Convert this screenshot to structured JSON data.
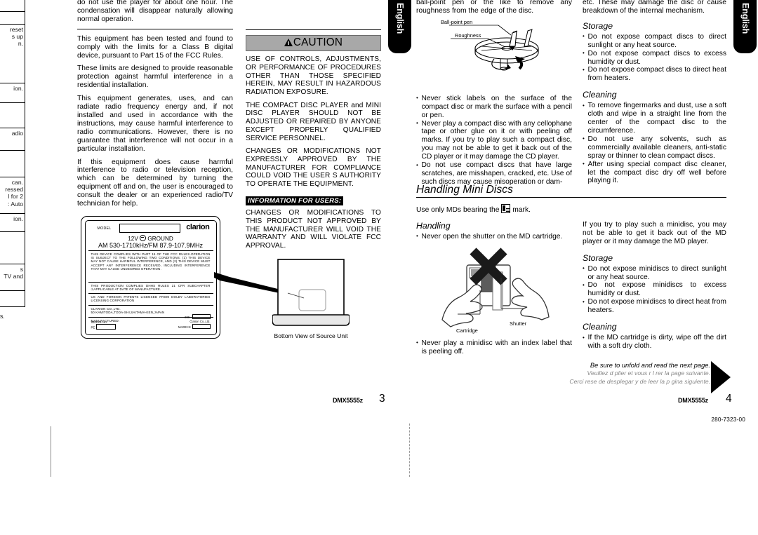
{
  "document": {
    "model": "DMX5555z",
    "doc_number": "280-7323-00",
    "page_left": "3",
    "page_right": "4",
    "tab_label": "English"
  },
  "left_crop": {
    "fragments": [
      "reset",
      "s up",
      "n.",
      "ion.",
      "adio",
      "can.",
      "ressed",
      "l for 2",
      ": Auto",
      "ion.",
      "s",
      "TV and"
    ],
    "tail": "s."
  },
  "col1": {
    "intro_top": "do not use the player for about one hour. The condensation will disappear naturally allowing normal operation.",
    "fcc_paragraphs": [
      "This equipment has been tested and found to comply with the limits for a Class B digital device, pursuant to Part 15 of the FCC Rules.",
      "These limits are designed to provide reasonable protection against harmful interference in a residential installation.",
      "This equipment generates, uses, and can radiate radio frequency energy and, if not installed and used in accordance with the instructions, may cause harmful interference to radio communications. However, there is no guarantee that interference will not occur in a particular installation.",
      "If this equipment does cause harmful interference to radio or television reception, which can be determined by turning the equipment off and on, the user is encouraged to consult the dealer or an experienced radio/TV technician for help."
    ]
  },
  "caution": {
    "title": "CAUTION",
    "paragraphs": [
      "USE OF CONTROLS, ADJUSTMENTS, OR PERFORMANCE OF PROCEDURES OTHER THAN THOSE SPECIFIED HEREIN, MAY RESULT IN HAZARDOUS RADIATION EXPOSURE.",
      "THE COMPACT DISC PLAYER and MINI DISC PLAYER SHOULD NOT BE ADJUSTED OR REPAIRED BY ANYONE EXCEPT PROPERLY QUALIFIED SERVICE PERSONNEL.",
      "CHANGES OR MODIFICATIONS NOT EXPRESSLY APPROVED BY THE MANUFACTURER FOR COMPLIANCE COULD VOID THE USER S AUTHORITY TO OPERATE THE EQUIPMENT."
    ],
    "info_bar": "INFORMATION FOR USERS:",
    "info_paragraph": "CHANGES OR MODIFICATIONS TO THIS PRODUCT NOT APPROVED BY THE MANUFACTURER WILL VOID THE WARRANTY AND WILL VIOLATE FCC APPROVAL."
  },
  "label": {
    "model_caption": "MODEL",
    "brand": "clarion",
    "voltage": "12V",
    "ground": "GROUND",
    "bands": "AM 530-1710kHz/FM 87.9-107.9MHz",
    "block_fcc": "THIS DEVICE COMPLIES WITH PART 15 OF THE FCC RULES.OPERATION IS SUBJECT TO THE FOLLOWING TWO CONDITIONS: (1) THIS DEVICE MAY NOT CAUSE HARMFUL INTERFERENCE, AND (2) THIS DEVICE MUST ACCEPT ANY INTERFERENCE RECEIVED, INCLUDING INTERFERENCE THAT MAY CAUSE UNDESIRED OPERATION.",
    "block_dhhs": "THIS PRODUCTION COMPLIES DHHS RULES 21 CFR SUBCHAPTER J,APPLICABLE AT DATE OF MANUFACTURE.",
    "block_dolby": "US AND FOREIGN PATENTS LICENSED FROM DOLBY LABORATORIES LICENSING CORPORATION",
    "block_company": "CLARION CO.,LTD.<br>50 KAMITODA,TODA-SHI,SAITAMA-KEN,JAPAN",
    "block_manufactured": "MANUFACTURED:",
    "serial_label": "SERIAL No.",
    "pe_label": "PE",
    "right_286": "286-",
    "right_company": "Clarion Co.,Ltd.",
    "right_madein": "MADE IN"
  },
  "bottom_view_caption": "Bottom View of Source Unit",
  "col3": {
    "intro_top": "ball-point pen or the like to remove any roughness from the edge of the disc.",
    "fig_labels": {
      "pen": "Ball-point pen",
      "roughness": "Roughness"
    },
    "bullets": [
      "Never stick labels on the surface of the compact disc or mark the surface with a pencil or pen.",
      "Never play a compact disc with any cellophane tape or other glue on it or with peeling off marks. If you try to play such a compact disc, you may not be able to get it back out of the CD player or it may damage the CD player.",
      "Do not use compact discs that have large scratches, are misshapen, cracked, etc. Use of such discs may cause misoperation or dam-"
    ]
  },
  "col4": {
    "intro_top": "etc. These may damage the disc or cause breakdown of the internal mechanism.",
    "storage": {
      "title": "Storage",
      "bullets": [
        "Do not expose compact discs to direct sunlight or any heat source.",
        "Do not expose compact discs to excess humidity or dust.",
        "Do not expose compact discs to direct heat from heaters."
      ]
    },
    "cleaning": {
      "title": "Cleaning",
      "bullets": [
        "To remove fingermarks and dust, use a soft cloth and wipe in a straight line from the center of the compact disc to the circumference.",
        "Do not use any solvents, such as commercially available cleaners, anti-static spray or thinner to clean compact discs.",
        "After using special compact disc cleaner, let the compact disc dry off well before playing it."
      ]
    }
  },
  "minidisc": {
    "heading": "Handling Mini Discs",
    "use_only_pre": "Use only MDs bearing the",
    "use_only_post": "mark.",
    "handling": {
      "title": "Handling",
      "bullets": [
        "Never open the shutter on the MD cartridge."
      ]
    },
    "fig_labels": {
      "cartridge": "Cartridge",
      "shutter": "Shutter"
    },
    "bullet_index": "Never play a minidisc with an index label that is peeling off.",
    "continued": "If you try to play such a minidisc, you may not be able to get it back out of the MD player or it may damage the MD player.",
    "storage": {
      "title": "Storage",
      "bullets": [
        "Do not expose minidiscs to direct sunlight or any heat source.",
        "Do not expose minidiscs to excess humidity or dust.",
        "Do not expose minidiscs to direct heat from heaters."
      ]
    },
    "cleaning": {
      "title": "Cleaning",
      "bullets": [
        "If the MD cartridge is dirty, wipe off the dirt with a soft dry cloth."
      ]
    }
  },
  "unfold": {
    "english": "Be sure to unfold and read the next page.",
    "french": "Veuillez d    plier et vous r     l  rer     la page suivante.",
    "spanish": "Cerci    rese de desplegar y de leer la p      gina siguiente."
  }
}
